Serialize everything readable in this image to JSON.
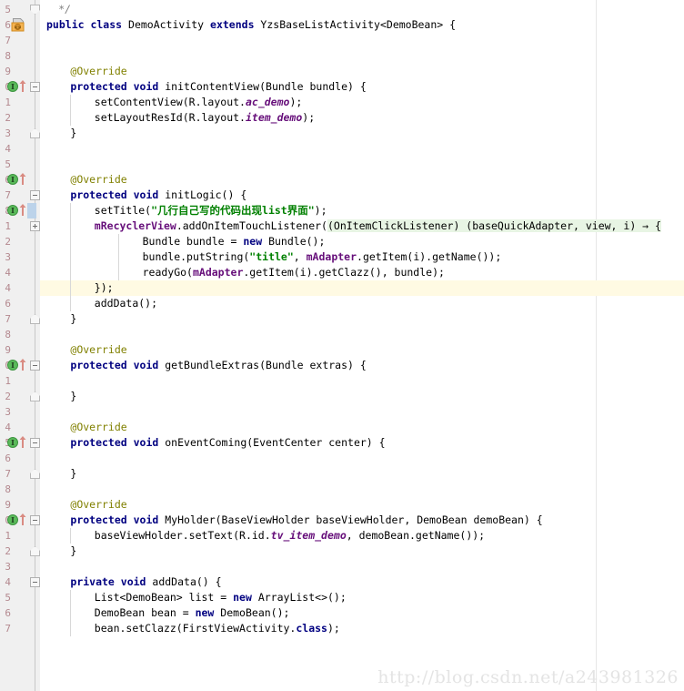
{
  "editor": {
    "language": "java",
    "theme": "intellij-light",
    "colors": {
      "background": "#ffffff",
      "gutter_background": "#f0f0f0",
      "line_number": "#b4898f",
      "keyword": "#000080",
      "annotation": "#808000",
      "string": "#008000",
      "field": "#660e7a",
      "static_field": "#660e7a",
      "current_line_highlight": "#fffae3",
      "search_match_highlight": "#e8f5e4",
      "change_bar": "#bcd3ea",
      "margin_guide": "#e6e6e6",
      "watermark": "#e4e4e4"
    },
    "current_line_index": 20,
    "margin_guide_column_x": 655
  },
  "watermark": {
    "text": "http://blog.csdn.net/a243981326"
  },
  "gutter": {
    "line_numbers": [
      "5",
      "6",
      "7",
      "8",
      "9",
      "0",
      "1",
      "2",
      "3",
      "4",
      "5",
      "6",
      "7",
      "8",
      "1",
      "2",
      "3",
      "4",
      "6",
      "7",
      "8",
      "9",
      "0",
      "1",
      "2",
      "3",
      "4",
      "5",
      "6",
      "7",
      "8",
      "9",
      "0",
      "1",
      "2",
      "3",
      "4",
      "5",
      "6",
      "7"
    ],
    "markers": [
      {
        "line": 1,
        "type": "class-icon",
        "name": "java-class-marker"
      },
      {
        "line": 5,
        "type": "override-icon",
        "name": "implementing-method-marker"
      },
      {
        "line": 11,
        "type": "override-icon",
        "name": "implementing-method-marker"
      },
      {
        "line": 13,
        "type": "override-icon",
        "name": "implementing-method-marker"
      },
      {
        "line": 24,
        "type": "override-icon",
        "name": "implementing-method-marker"
      },
      {
        "line": 30,
        "type": "override-icon",
        "name": "implementing-method-marker"
      },
      {
        "line": 36,
        "type": "override-icon",
        "name": "implementing-method-marker"
      }
    ]
  },
  "code": {
    "lines": [
      {
        "n": "5",
        "indent": 2,
        "tokens": [
          {
            "t": "*/",
            "c": "cmt"
          }
        ]
      },
      {
        "n": "6",
        "indent": 0,
        "tokens": [
          {
            "t": "public class ",
            "c": "kw"
          },
          {
            "t": "DemoActivity ",
            "c": "plain"
          },
          {
            "t": "extends ",
            "c": "kw"
          },
          {
            "t": "YzsBaseListActivity<DemoBean> {",
            "c": "plain"
          }
        ]
      },
      {
        "n": "7",
        "indent": 0,
        "tokens": []
      },
      {
        "n": "8",
        "indent": 0,
        "tokens": []
      },
      {
        "n": "9",
        "indent": 4,
        "tokens": [
          {
            "t": "@Override",
            "c": "anno"
          }
        ]
      },
      {
        "n": "0",
        "indent": 4,
        "tokens": [
          {
            "t": "protected void ",
            "c": "kw"
          },
          {
            "t": "initContentView(Bundle bundle) {",
            "c": "plain"
          }
        ]
      },
      {
        "n": "1",
        "indent": 8,
        "tokens": [
          {
            "t": "setContentView(R.layout.",
            "c": "plain"
          },
          {
            "t": "ac_demo",
            "c": "static"
          },
          {
            "t": ");",
            "c": "plain"
          }
        ]
      },
      {
        "n": "2",
        "indent": 8,
        "tokens": [
          {
            "t": "setLayoutResId(R.layout.",
            "c": "plain"
          },
          {
            "t": "item_demo",
            "c": "static"
          },
          {
            "t": ");",
            "c": "plain"
          }
        ]
      },
      {
        "n": "3",
        "indent": 4,
        "tokens": [
          {
            "t": "}",
            "c": "plain"
          }
        ]
      },
      {
        "n": "4",
        "indent": 0,
        "tokens": []
      },
      {
        "n": "5",
        "indent": 0,
        "tokens": []
      },
      {
        "n": "6",
        "indent": 4,
        "tokens": [
          {
            "t": "@Override",
            "c": "anno"
          }
        ]
      },
      {
        "n": "7",
        "indent": 4,
        "tokens": [
          {
            "t": "protected void ",
            "c": "kw"
          },
          {
            "t": "initLogic() {",
            "c": "plain"
          }
        ]
      },
      {
        "n": "8",
        "indent": 8,
        "tokens": [
          {
            "t": "setTitle(",
            "c": "plain"
          },
          {
            "t": "\"几行自己写的代码出现list界面\"",
            "c": "str"
          },
          {
            "t": ");",
            "c": "plain"
          }
        ]
      },
      {
        "n": "1",
        "indent": 8,
        "tokens": [
          {
            "t": "mRecyclerView",
            "c": "field"
          },
          {
            "t": ".addOnItemTouchListener(",
            "c": "plain"
          },
          {
            "t": "(OnItemClickListener) (baseQuickAdapter, view, i) → {",
            "c": "plain",
            "hl": "search"
          }
        ]
      },
      {
        "n": "2",
        "indent": 16,
        "tokens": [
          {
            "t": "Bundle bundle = ",
            "c": "plain"
          },
          {
            "t": "new ",
            "c": "kw"
          },
          {
            "t": "Bundle();",
            "c": "plain"
          }
        ]
      },
      {
        "n": "3",
        "indent": 16,
        "tokens": [
          {
            "t": "bundle.putString(",
            "c": "plain"
          },
          {
            "t": "\"title\"",
            "c": "str"
          },
          {
            "t": ", ",
            "c": "plain"
          },
          {
            "t": "mAdapter",
            "c": "field"
          },
          {
            "t": ".getItem(i).getName());",
            "c": "plain"
          }
        ]
      },
      {
        "n": "4",
        "indent": 16,
        "tokens": [
          {
            "t": "readyGo(",
            "c": "plain"
          },
          {
            "t": "mAdapter",
            "c": "field"
          },
          {
            "t": ".getItem(i).getClazz(), bundle);",
            "c": "plain"
          }
        ]
      },
      {
        "n": "4",
        "indent": 8,
        "tokens": [
          {
            "t": "});",
            "c": "plain"
          }
        ],
        "current": true
      },
      {
        "n": "6",
        "indent": 8,
        "tokens": [
          {
            "t": "addData();",
            "c": "plain"
          }
        ]
      },
      {
        "n": "7",
        "indent": 4,
        "tokens": [
          {
            "t": "}",
            "c": "plain"
          }
        ]
      },
      {
        "n": "8",
        "indent": 0,
        "tokens": []
      },
      {
        "n": "9",
        "indent": 4,
        "tokens": [
          {
            "t": "@Override",
            "c": "anno"
          }
        ]
      },
      {
        "n": "0",
        "indent": 4,
        "tokens": [
          {
            "t": "protected void ",
            "c": "kw"
          },
          {
            "t": "getBundleExtras(Bundle extras) {",
            "c": "plain"
          }
        ]
      },
      {
        "n": "1",
        "indent": 0,
        "tokens": []
      },
      {
        "n": "2",
        "indent": 4,
        "tokens": [
          {
            "t": "}",
            "c": "plain"
          }
        ]
      },
      {
        "n": "3",
        "indent": 0,
        "tokens": []
      },
      {
        "n": "4",
        "indent": 4,
        "tokens": [
          {
            "t": "@Override",
            "c": "anno"
          }
        ]
      },
      {
        "n": "5",
        "indent": 4,
        "tokens": [
          {
            "t": "protected void ",
            "c": "kw"
          },
          {
            "t": "onEventComing(EventCenter center) {",
            "c": "plain"
          }
        ]
      },
      {
        "n": "6",
        "indent": 0,
        "tokens": []
      },
      {
        "n": "7",
        "indent": 4,
        "tokens": [
          {
            "t": "}",
            "c": "plain"
          }
        ]
      },
      {
        "n": "8",
        "indent": 0,
        "tokens": []
      },
      {
        "n": "9",
        "indent": 4,
        "tokens": [
          {
            "t": "@Override",
            "c": "anno"
          }
        ]
      },
      {
        "n": "0",
        "indent": 4,
        "tokens": [
          {
            "t": "protected void ",
            "c": "kw"
          },
          {
            "t": "MyHolder(BaseViewHolder baseViewHolder, DemoBean demoBean) {",
            "c": "plain"
          }
        ]
      },
      {
        "n": "1",
        "indent": 8,
        "tokens": [
          {
            "t": "baseViewHolder.setText(R.id.",
            "c": "plain"
          },
          {
            "t": "tv_item_demo",
            "c": "static"
          },
          {
            "t": ", demoBean.getName());",
            "c": "plain"
          }
        ]
      },
      {
        "n": "2",
        "indent": 4,
        "tokens": [
          {
            "t": "}",
            "c": "plain"
          }
        ]
      },
      {
        "n": "3",
        "indent": 0,
        "tokens": []
      },
      {
        "n": "4",
        "indent": 4,
        "tokens": [
          {
            "t": "private void ",
            "c": "kw"
          },
          {
            "t": "addData() {",
            "c": "plain"
          }
        ]
      },
      {
        "n": "5",
        "indent": 8,
        "tokens": [
          {
            "t": "List<DemoBean> list = ",
            "c": "plain"
          },
          {
            "t": "new ",
            "c": "kw"
          },
          {
            "t": "ArrayList<>();",
            "c": "plain"
          }
        ]
      },
      {
        "n": "6",
        "indent": 8,
        "tokens": [
          {
            "t": "DemoBean bean = ",
            "c": "plain"
          },
          {
            "t": "new ",
            "c": "kw"
          },
          {
            "t": "DemoBean();",
            "c": "plain"
          }
        ]
      },
      {
        "n": "7",
        "indent": 8,
        "tokens": [
          {
            "t": "bean.setClazz(FirstViewActivity.",
            "c": "plain"
          },
          {
            "t": "class",
            "c": "kw"
          },
          {
            "t": ");",
            "c": "plain"
          }
        ]
      }
    ]
  }
}
